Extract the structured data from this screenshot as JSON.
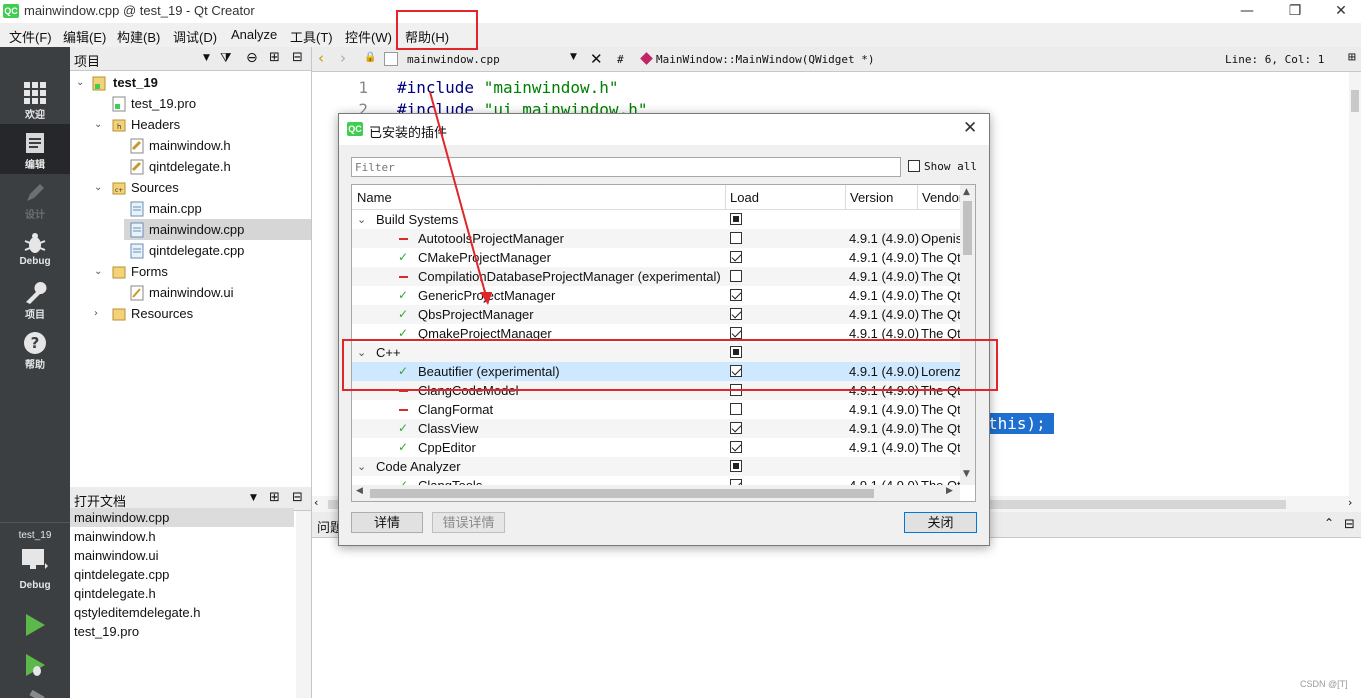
{
  "window": {
    "title": "mainwindow.cpp @ test_19 - Qt Creator",
    "logo": "QC",
    "controls": [
      "—",
      "❐",
      "✕"
    ]
  },
  "menubar": {
    "items": [
      "文件(F)",
      "编辑(E)",
      "构建(B)",
      "调试(D)",
      "Analyze",
      "工具(T)",
      "控件(W)",
      "帮助(H)"
    ]
  },
  "modebar": {
    "modes": [
      {
        "label": "欢迎",
        "icon": "grid-icon"
      },
      {
        "label": "编辑",
        "icon": "document-icon"
      },
      {
        "label": "设计",
        "icon": "pencil-icon"
      },
      {
        "label": "Debug",
        "icon": "bug-icon"
      },
      {
        "label": "项目",
        "icon": "wrench-icon"
      },
      {
        "label": "帮助",
        "icon": "help-icon"
      }
    ],
    "target_project": "test_19",
    "target_config": "Debug"
  },
  "project_pane": {
    "title": "项目",
    "tree": [
      {
        "label": "test_19",
        "level": 0,
        "expanded": true,
        "bold": true
      },
      {
        "label": "test_19.pro",
        "level": 1
      },
      {
        "label": "Headers",
        "level": 1,
        "expanded": true
      },
      {
        "label": "mainwindow.h",
        "level": 2
      },
      {
        "label": "qintdelegate.h",
        "level": 2
      },
      {
        "label": "Sources",
        "level": 1,
        "expanded": true
      },
      {
        "label": "main.cpp",
        "level": 2
      },
      {
        "label": "mainwindow.cpp",
        "level": 2,
        "selected": true
      },
      {
        "label": "qintdelegate.cpp",
        "level": 2
      },
      {
        "label": "Forms",
        "level": 1,
        "expanded": true
      },
      {
        "label": "mainwindow.ui",
        "level": 2
      },
      {
        "label": "Resources",
        "level": 1,
        "expanded": false
      }
    ]
  },
  "open_docs": {
    "title": "打开文档",
    "items": [
      "mainwindow.cpp",
      "mainwindow.h",
      "mainwindow.ui",
      "qintdelegate.cpp",
      "qintdelegate.h",
      "qstyleditemdelegate.h",
      "test_19.pro"
    ]
  },
  "editor": {
    "file": "mainwindow.cpp",
    "hash": "#",
    "symbol": "MainWindow::MainWindow(QWidget *)",
    "position": "Line: 6, Col: 1",
    "lines": [
      {
        "no": "1",
        "pre": "#include ",
        "str": "\"mainwindow.h\""
      },
      {
        "no": "2",
        "pre": "#include ",
        "str": "\"ui_mainwindow.h\""
      }
    ],
    "selected_fragment": "this);"
  },
  "output": {
    "label": "问题"
  },
  "dialog": {
    "title": "已安装的插件",
    "filter_placeholder": "Filter",
    "show_all": "Show all",
    "columns": [
      "Name",
      "Load",
      "Version",
      "Vendor"
    ],
    "rows": [
      {
        "type": "group",
        "name": "Build Systems",
        "load": "partial"
      },
      {
        "type": "plugin",
        "status": "no",
        "name": "AutotoolsProjectManager",
        "load": false,
        "version": "4.9.1 (4.9.0)",
        "vendor": "Openismus"
      },
      {
        "type": "plugin",
        "status": "ok",
        "name": "CMakeProjectManager",
        "load": true,
        "version": "4.9.1 (4.9.0)",
        "vendor": "The Qt Company"
      },
      {
        "type": "plugin",
        "status": "no",
        "name": "CompilationDatabaseProjectManager (experimental)",
        "load": false,
        "version": "4.9.1 (4.9.0)",
        "vendor": "The Qt Company"
      },
      {
        "type": "plugin",
        "status": "ok",
        "name": "GenericProjectManager",
        "load": true,
        "version": "4.9.1 (4.9.0)",
        "vendor": "The Qt Company"
      },
      {
        "type": "plugin",
        "status": "ok",
        "name": "QbsProjectManager",
        "load": true,
        "version": "4.9.1 (4.9.0)",
        "vendor": "The Qt Company"
      },
      {
        "type": "plugin",
        "status": "ok",
        "name": "QmakeProjectManager",
        "load": true,
        "version": "4.9.1 (4.9.0)",
        "vendor": "The Qt Company"
      },
      {
        "type": "group",
        "name": "C++",
        "load": "partial"
      },
      {
        "type": "plugin",
        "status": "ok",
        "name": "Beautifier (experimental)",
        "load": true,
        "version": "4.9.1 (4.9.0)",
        "vendor": "Lorenz",
        "selected": true
      },
      {
        "type": "plugin",
        "status": "no",
        "name": "ClangCodeModel",
        "load": false,
        "version": "4.9.1 (4.9.0)",
        "vendor": "The Qt Company"
      },
      {
        "type": "plugin",
        "status": "no",
        "name": "ClangFormat",
        "load": false,
        "version": "4.9.1 (4.9.0)",
        "vendor": "The Qt Company"
      },
      {
        "type": "plugin",
        "status": "ok",
        "name": "ClassView",
        "load": true,
        "version": "4.9.1 (4.9.0)",
        "vendor": "The Qt Company"
      },
      {
        "type": "plugin",
        "status": "ok",
        "name": "CppEditor",
        "load": true,
        "version": "4.9.1 (4.9.0)",
        "vendor": "The Qt Company"
      },
      {
        "type": "group",
        "name": "Code Analyzer",
        "load": "partial"
      },
      {
        "type": "plugin",
        "status": "ok",
        "name": "ClangTools",
        "load": true,
        "version": "4.9.1 (4.9.0)",
        "vendor": "The Qt Company"
      }
    ],
    "buttons": {
      "details": "详情",
      "error_details": "错误详情",
      "close": "关闭"
    }
  },
  "annotation_color": "#e0262a",
  "watermark": "CSDN @[T]"
}
